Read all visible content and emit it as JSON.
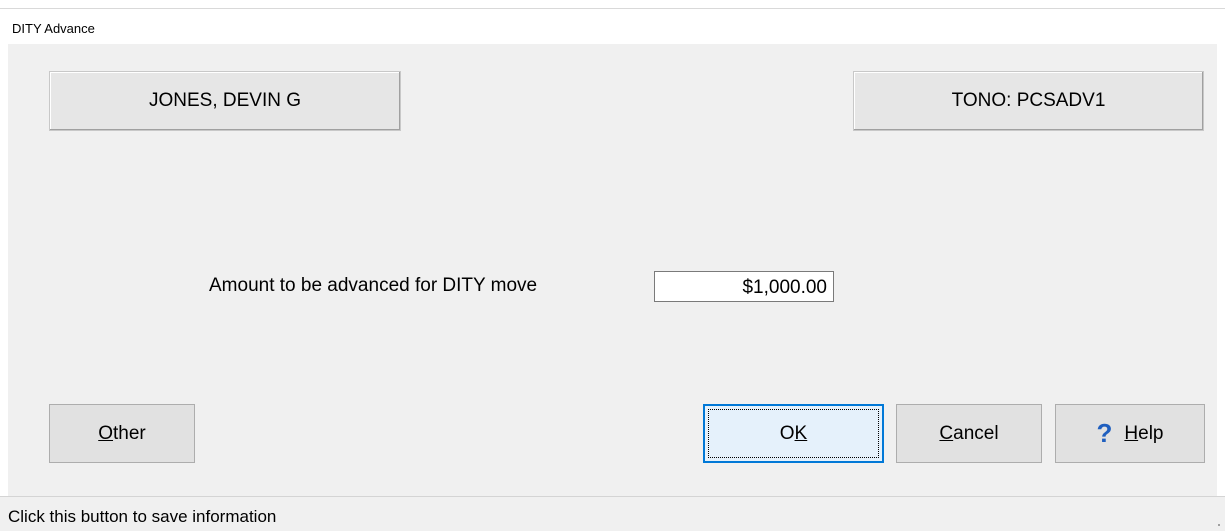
{
  "window": {
    "title": "DITY Advance"
  },
  "header": {
    "member_name": "JONES, DEVIN G",
    "tono": "TONO: PCSADV1"
  },
  "form": {
    "amount_label": "Amount to be advanced for DITY move",
    "amount_value": "$1,000.00"
  },
  "buttons": {
    "other": {
      "accel": "O",
      "rest": "ther"
    },
    "ok": {
      "pre": "O",
      "accel": "K"
    },
    "cancel": {
      "accel": "C",
      "rest": "ancel"
    },
    "help": {
      "icon": "?",
      "accel": "H",
      "rest": "elp"
    }
  },
  "status": {
    "text": "Click this button to save information"
  },
  "colors": {
    "focus_border": "#0078d7",
    "help_icon": "#1f5fbf",
    "dialog_bg": "#f0f0f0"
  },
  "icons": {
    "help": "help-question-icon",
    "grip": "resize-grip-icon"
  }
}
